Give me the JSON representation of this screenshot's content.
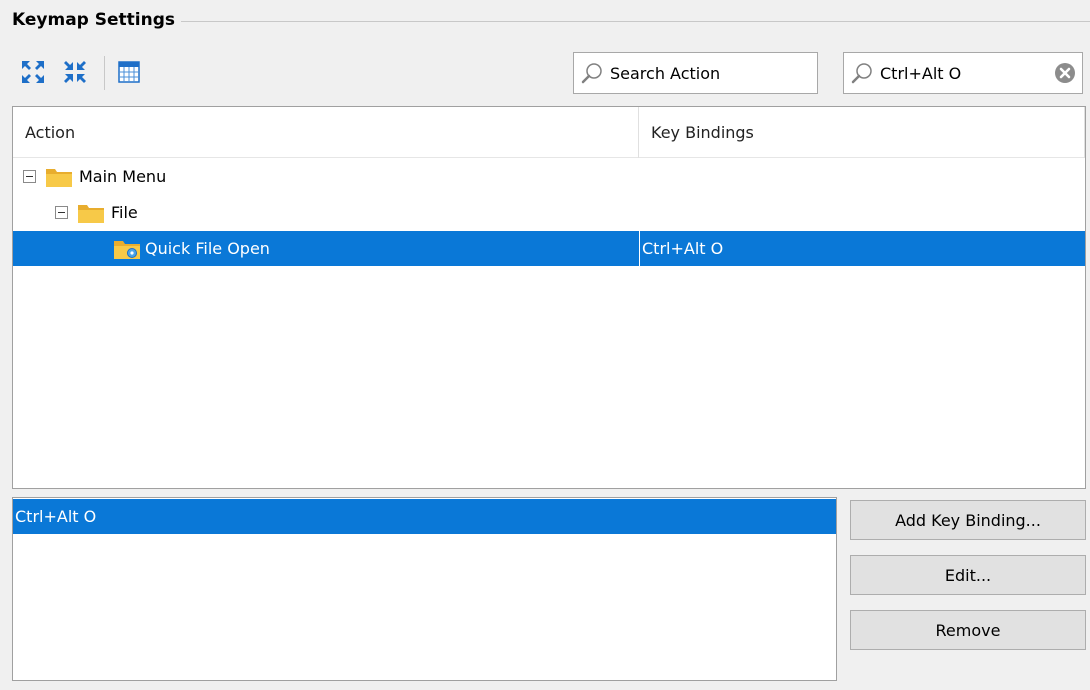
{
  "panel": {
    "title": "Keymap Settings"
  },
  "toolbar": {
    "expand_icon": "expand-all-icon",
    "collapse_icon": "collapse-all-icon",
    "table_icon": "table-icon"
  },
  "search": {
    "action_placeholder": "Search Action",
    "keys_value": "Ctrl+Alt O"
  },
  "tree": {
    "columns": [
      "Action",
      "Key Bindings"
    ],
    "rows": [
      {
        "label": "Main Menu",
        "binding": ""
      },
      {
        "label": "File",
        "binding": ""
      },
      {
        "label": "Quick File Open",
        "binding": "Ctrl+Alt O"
      }
    ]
  },
  "bindings": {
    "items": [
      "Ctrl+Alt O"
    ]
  },
  "buttons": {
    "add": "Add Key Binding...",
    "edit": "Edit...",
    "remove": "Remove"
  },
  "colors": {
    "selection": "#0a78d7",
    "folder": "#f5c541",
    "icon_blue": "#1e6fc8"
  }
}
